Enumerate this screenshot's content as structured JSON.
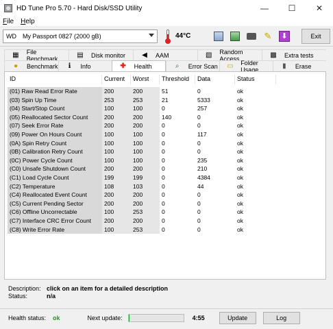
{
  "window": {
    "title": "HD Tune Pro 5.70 - Hard Disk/SSD Utility",
    "minimize_glyph": "—",
    "maximize_glyph": "☐",
    "close_glyph": "✕"
  },
  "menu": [
    {
      "label": "File",
      "accel": "F",
      "rest": "ile"
    },
    {
      "label": "Help",
      "accel": "H",
      "rest": "elp"
    }
  ],
  "toolbar": {
    "drive_letter": "WD",
    "drive_name": "My Passport 0827 (2000 gB)",
    "temperature": "44°C",
    "exit_label": "Exit",
    "icons": [
      "copy-text-icon",
      "copy-screenshot-icon",
      "camera-icon",
      "options-wrench-icon",
      "save-download-icon"
    ]
  },
  "tabs_row1": [
    {
      "label": "File Benchmark",
      "icon": "file-benchmark-icon",
      "glyph": "▦"
    },
    {
      "label": "Disk monitor",
      "icon": "disk-monitor-icon",
      "glyph": "▤"
    },
    {
      "label": "AAM",
      "icon": "speaker-icon",
      "glyph": "◀"
    },
    {
      "label": "Random Access",
      "icon": "random-access-icon",
      "glyph": "▧"
    },
    {
      "label": "Extra tests",
      "icon": "extra-tests-icon",
      "glyph": "▩"
    }
  ],
  "tabs_row2": [
    {
      "label": "Benchmark",
      "icon": "benchmark-icon",
      "glyph": "●"
    },
    {
      "label": "Info",
      "icon": "info-icon",
      "glyph": "ℹ"
    },
    {
      "label": "Health",
      "icon": "health-plus-icon",
      "glyph": "✚",
      "active": true
    },
    {
      "label": "Error Scan",
      "icon": "error-scan-icon",
      "glyph": "🔍"
    },
    {
      "label": "Folder Usage",
      "icon": "folder-icon",
      "glyph": "▭"
    },
    {
      "label": "Erase",
      "icon": "trash-icon",
      "glyph": "▮"
    }
  ],
  "health_table": {
    "columns": [
      "ID",
      "Current",
      "Worst",
      "Threshold",
      "Data",
      "Status"
    ],
    "rows": [
      [
        "(01) Raw Read Error Rate",
        "200",
        "200",
        "51",
        "0",
        "ok"
      ],
      [
        "(03) Spin Up Time",
        "253",
        "253",
        "21",
        "5333",
        "ok"
      ],
      [
        "(04) Start/Stop Count",
        "100",
        "100",
        "0",
        "257",
        "ok"
      ],
      [
        "(05) Reallocated Sector Count",
        "200",
        "200",
        "140",
        "0",
        "ok"
      ],
      [
        "(07) Seek Error Rate",
        "200",
        "200",
        "0",
        "0",
        "ok"
      ],
      [
        "(09) Power On Hours Count",
        "100",
        "100",
        "0",
        "117",
        "ok"
      ],
      [
        "(0A) Spin Retry Count",
        "100",
        "100",
        "0",
        "0",
        "ok"
      ],
      [
        "(0B) Calibration Retry Count",
        "100",
        "100",
        "0",
        "0",
        "ok"
      ],
      [
        "(0C) Power Cycle Count",
        "100",
        "100",
        "0",
        "235",
        "ok"
      ],
      [
        "(C0) Unsafe Shutdown Count",
        "200",
        "200",
        "0",
        "210",
        "ok"
      ],
      [
        "(C1) Load Cycle Count",
        "199",
        "199",
        "0",
        "4384",
        "ok"
      ],
      [
        "(C2) Temperature",
        "108",
        "103",
        "0",
        "44",
        "ok"
      ],
      [
        "(C4) Reallocated Event Count",
        "200",
        "200",
        "0",
        "0",
        "ok"
      ],
      [
        "(C5) Current Pending Sector",
        "200",
        "200",
        "0",
        "0",
        "ok"
      ],
      [
        "(C6) Offline Uncorrectable",
        "100",
        "253",
        "0",
        "0",
        "ok"
      ],
      [
        "(C7) Interface CRC Error Count",
        "200",
        "200",
        "0",
        "0",
        "ok"
      ],
      [
        "(C8) Write Error Rate",
        "100",
        "253",
        "0",
        "0",
        "ok"
      ]
    ]
  },
  "description": {
    "desc_label": "Description:",
    "desc_value": "click on an item for a detailed description",
    "status_label": "Status:",
    "status_value": "n/a"
  },
  "bottom": {
    "health_label": "Health status:",
    "health_value": "ok",
    "next_update_label": "Next update:",
    "progress_fraction": 0.02,
    "countdown": "4:55",
    "update_label": "Update",
    "log_label": "Log"
  },
  "colors": {
    "ok_green": "#1a9e1a",
    "progress_green": "#06b025",
    "health_icon_red": "#d21111"
  }
}
